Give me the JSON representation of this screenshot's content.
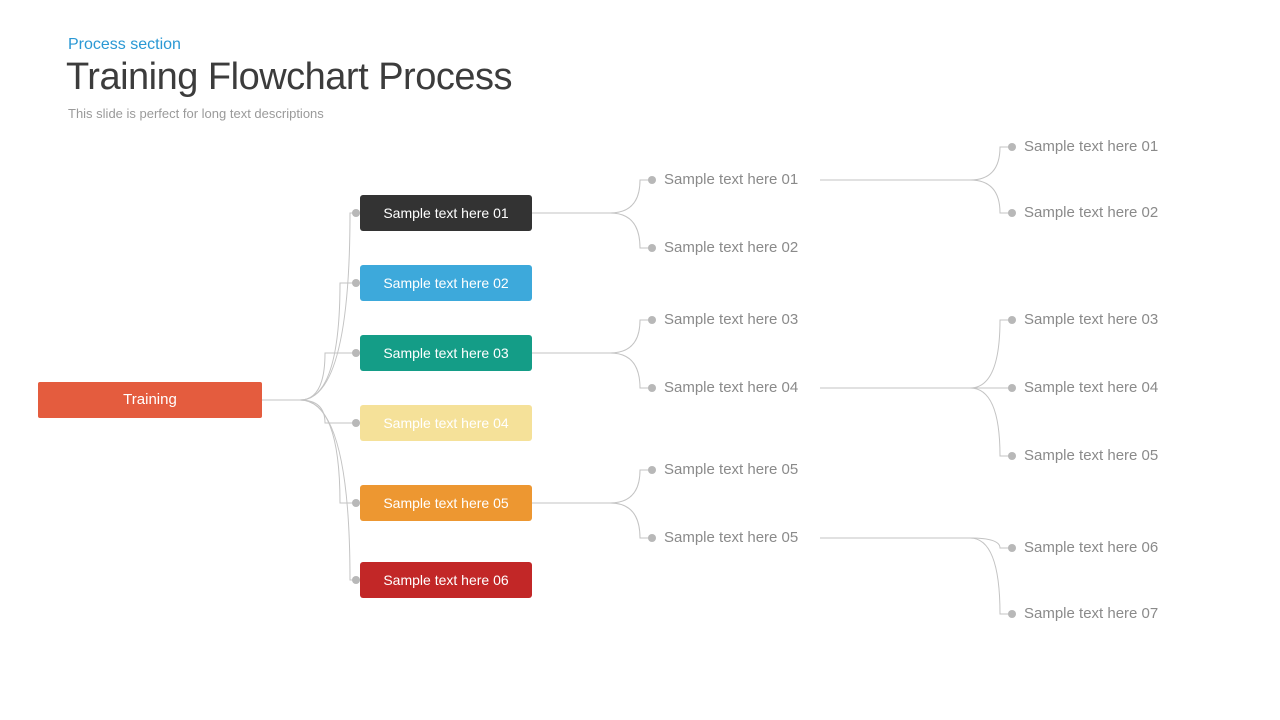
{
  "header": {
    "eyebrow": "Process section",
    "title": "Training Flowchart Process",
    "subtitle": "This slide is perfect for long text descriptions"
  },
  "colors": {
    "root": "#e45c3e",
    "lvl1_1": "#333333",
    "lvl1_2": "#3da9db",
    "lvl1_3": "#149d87",
    "lvl1_4": "#f5e199",
    "lvl1_5": "#ed9731",
    "lvl1_6": "#c22727"
  },
  "tree": {
    "root": "Training",
    "level1": [
      "Sample text here 01",
      "Sample text here 02",
      "Sample text here 03",
      "Sample text here 04",
      "Sample text here 05",
      "Sample text here 06"
    ],
    "level2_groupA": [
      "Sample text here 01",
      "Sample text here 02"
    ],
    "level2_groupB": [
      "Sample text here 03",
      "Sample text here 04"
    ],
    "level2_groupC": [
      "Sample text here 05",
      "Sample text here 05"
    ],
    "level3_groupA": [
      "Sample text here 01",
      "Sample text here 02"
    ],
    "level3_groupB": [
      "Sample text here 03",
      "Sample text here 04",
      "Sample text here 05"
    ],
    "level3_groupC": [
      "Sample text here 06",
      "Sample text here 07"
    ]
  },
  "chart_data": {
    "type": "tree",
    "title": "Training Flowchart Process",
    "root": {
      "label": "Training",
      "children": [
        {
          "label": "Sample text here 01",
          "color": "#333333",
          "children": [
            {
              "label": "Sample text here 01",
              "children": [
                {
                  "label": "Sample text here 01"
                },
                {
                  "label": "Sample text here 02"
                }
              ]
            },
            {
              "label": "Sample text here 02"
            }
          ]
        },
        {
          "label": "Sample text here 02",
          "color": "#3da9db"
        },
        {
          "label": "Sample text here 03",
          "color": "#149d87",
          "children": [
            {
              "label": "Sample text here 03"
            },
            {
              "label": "Sample text here 04",
              "children": [
                {
                  "label": "Sample text here 03"
                },
                {
                  "label": "Sample text here 04"
                },
                {
                  "label": "Sample text here 05"
                }
              ]
            }
          ]
        },
        {
          "label": "Sample text here 04",
          "color": "#f5e199"
        },
        {
          "label": "Sample text here 05",
          "color": "#ed9731",
          "children": [
            {
              "label": "Sample text here 05"
            },
            {
              "label": "Sample text here 05",
              "children": [
                {
                  "label": "Sample text here 06"
                },
                {
                  "label": "Sample text here 07"
                }
              ]
            }
          ]
        },
        {
          "label": "Sample text here 06",
          "color": "#c22727"
        }
      ]
    }
  }
}
